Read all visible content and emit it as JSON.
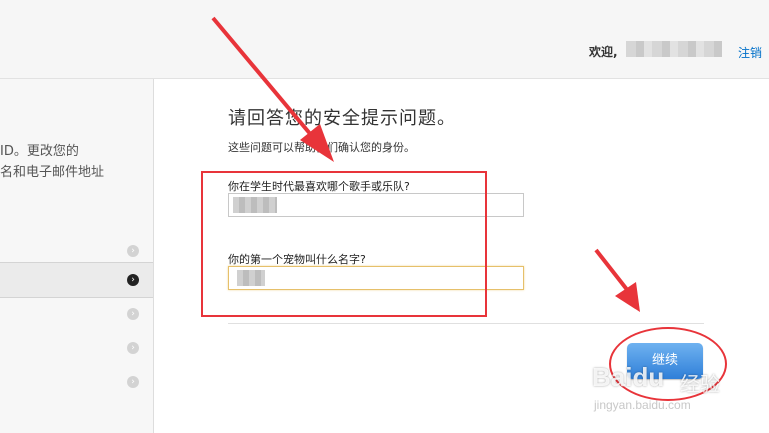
{
  "header": {
    "welcome_label": "欢迎,",
    "logout_label": "注销"
  },
  "sidebar": {
    "description": "ID。更改您的\n名和电子邮件地址",
    "items": [
      {
        "chevron": "chevron-right-icon"
      },
      {
        "chevron": "chevron-right-icon",
        "active": true
      },
      {
        "chevron": "chevron-right-icon"
      },
      {
        "chevron": "chevron-right-icon"
      },
      {
        "chevron": "chevron-right-icon"
      }
    ]
  },
  "main": {
    "title": "请回答您的安全提示问题。",
    "subtitle": "这些问题可以帮助我们确认您的身份。",
    "questions": [
      {
        "label": "你在学生时代最喜欢哪个歌手或乐队?"
      },
      {
        "label": "你的第一个宠物叫什么名字?"
      }
    ],
    "continue_label": "继续"
  },
  "watermark": {
    "brand": "Baidu",
    "brand_cn": "经验",
    "url": "jingyan.baidu.com"
  },
  "colors": {
    "accent": "#0070c9",
    "annotation": "#e8343a",
    "button": "#2f7fd8"
  }
}
